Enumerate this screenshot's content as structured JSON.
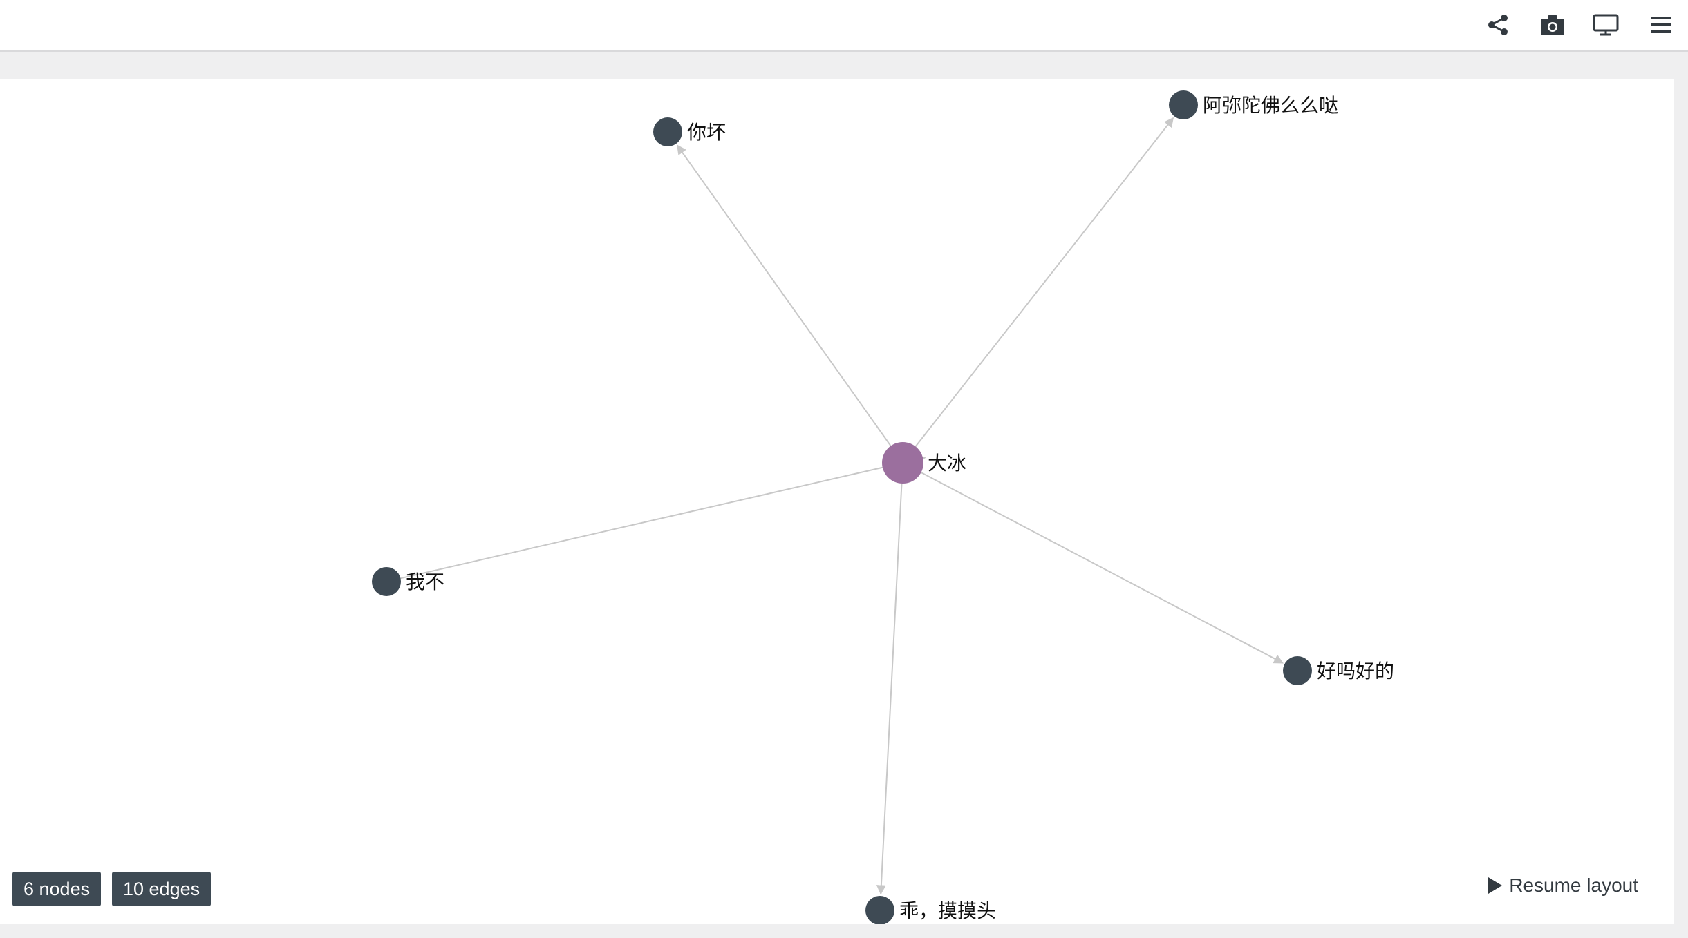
{
  "toolbar": {
    "icons": [
      "share-icon",
      "camera-icon",
      "monitor-icon",
      "menu-icon"
    ],
    "icon_color": "#333a40"
  },
  "graph": {
    "center_color": "#9b6f9e",
    "node_color": "#3e4a54",
    "edge_color": "#c8c8c8",
    "center": {
      "label": "大冰"
    },
    "nodes": [
      {
        "label": "你坏"
      },
      {
        "label": "阿弥陀佛么么哒"
      },
      {
        "label": "我不"
      },
      {
        "label": "好吗好的"
      },
      {
        "label": "乖，摸摸头"
      }
    ]
  },
  "stats": {
    "nodes_label": "6 nodes",
    "edges_label": "10 edges"
  },
  "controls": {
    "resume_label": "Resume layout"
  }
}
